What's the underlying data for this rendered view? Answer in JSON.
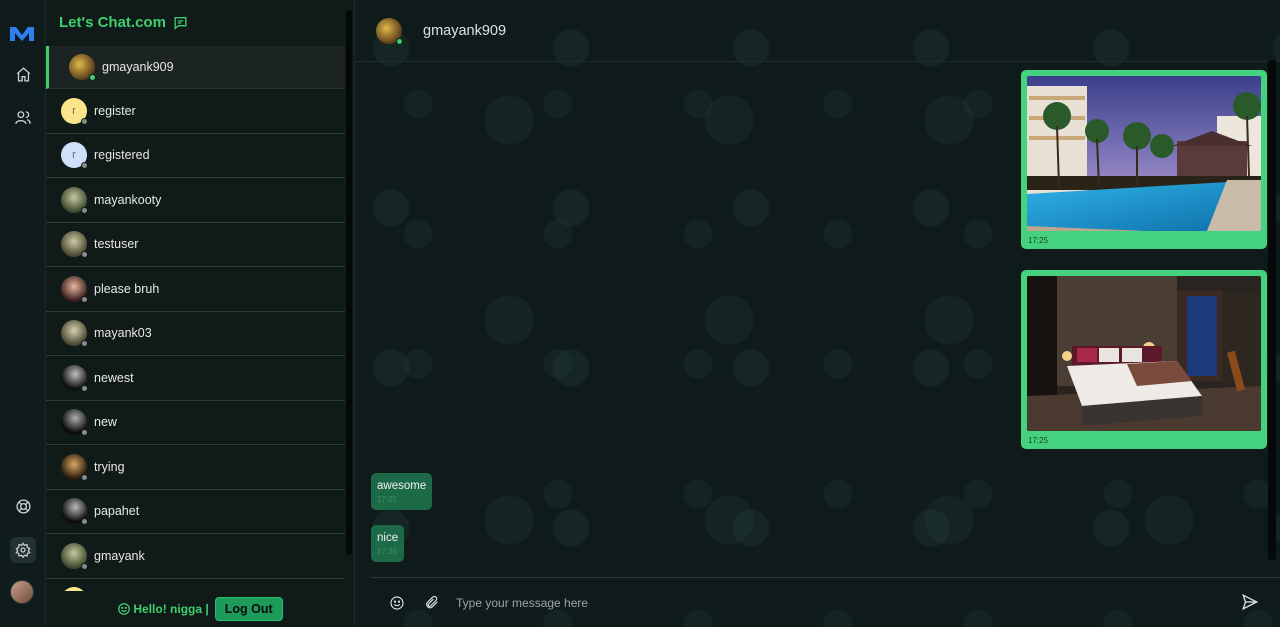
{
  "brand": {
    "title": "Let's Chat.com"
  },
  "rail": {
    "icons": [
      "logo-icon",
      "home-icon",
      "users-icon",
      "help-icon",
      "settings-icon"
    ]
  },
  "contacts": [
    {
      "name": "gmayank909",
      "active": true,
      "online": true
    },
    {
      "name": "register",
      "initial": "r",
      "online": false
    },
    {
      "name": "registered",
      "initial": "r",
      "online": false
    },
    {
      "name": "mayankooty",
      "online": false
    },
    {
      "name": "testuser",
      "online": false
    },
    {
      "name": "please bruh",
      "online": false
    },
    {
      "name": "mayank03",
      "online": false
    },
    {
      "name": "newest",
      "online": false
    },
    {
      "name": "new",
      "online": false
    },
    {
      "name": "trying",
      "online": false
    },
    {
      "name": "papahet",
      "online": false
    },
    {
      "name": "gmayank",
      "online": false
    }
  ],
  "footer": {
    "greeting": "Hello! nigga |",
    "logout_label": "Log Out"
  },
  "chat": {
    "header_name": "gmayank909",
    "image_messages": [
      {
        "time": "17:25",
        "subject": "resort-pool-photo"
      },
      {
        "time": "17:25",
        "subject": "hotel-bedroom-photo"
      }
    ],
    "text_messages": [
      {
        "text": "awesome",
        "time": "17:25"
      },
      {
        "text": "nice",
        "time": "17:25"
      }
    ],
    "composer_placeholder": "Type your message here"
  },
  "colors": {
    "accent": "#3ecf6e",
    "image_bubble": "#44d27e",
    "text_bubble": "#1c6a48",
    "background": "#0f1b1a"
  }
}
